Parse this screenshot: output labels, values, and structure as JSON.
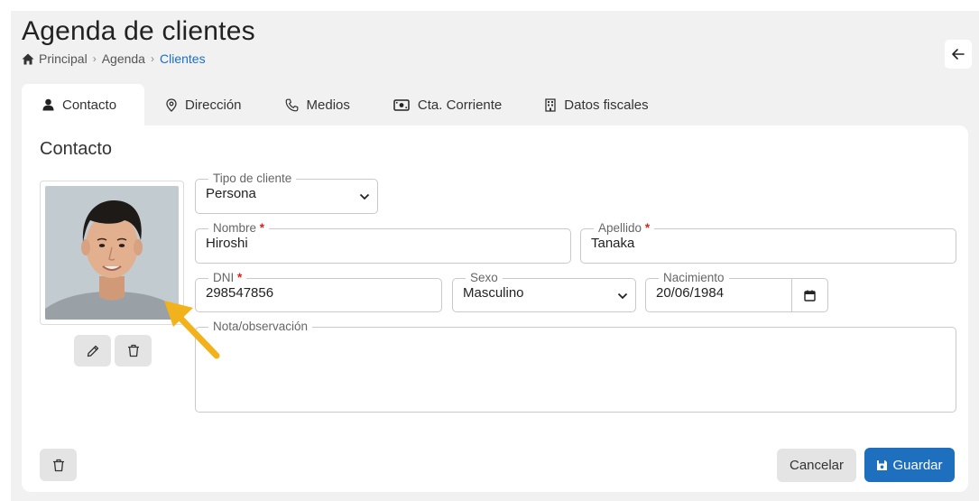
{
  "header": {
    "title": "Agenda de clientes",
    "breadcrumb": [
      "Principal",
      "Agenda",
      "Clientes"
    ]
  },
  "tabs": [
    {
      "label": "Contacto",
      "icon": "user-icon",
      "active": true
    },
    {
      "label": "Dirección",
      "icon": "map-pin-icon"
    },
    {
      "label": "Medios",
      "icon": "phone-icon"
    },
    {
      "label": "Cta. Corriente",
      "icon": "money-icon"
    },
    {
      "label": "Datos fiscales",
      "icon": "building-icon"
    }
  ],
  "form": {
    "section_title": "Contacto",
    "tipo_cliente": {
      "label": "Tipo de cliente",
      "value": "Persona"
    },
    "nombre": {
      "label": "Nombre",
      "value": "Hiroshi",
      "required_mark": "*"
    },
    "apellido": {
      "label": "Apellido",
      "value": "Tanaka",
      "required_mark": "*"
    },
    "dni": {
      "label": "DNI",
      "value": "298547856",
      "required_mark": "*"
    },
    "sexo": {
      "label": "Sexo",
      "value": "Masculino"
    },
    "nacimiento": {
      "label": "Nacimiento",
      "value": "20/06/1984"
    },
    "nota": {
      "label": "Nota/observación",
      "value": ""
    }
  },
  "actions": {
    "cancel_label": "Cancelar",
    "save_label": "Guardar"
  },
  "colors": {
    "primary": "#1f6fbf",
    "link": "#1a6fc2",
    "required": "#e01e1e",
    "arrow": "#f2b21b"
  }
}
